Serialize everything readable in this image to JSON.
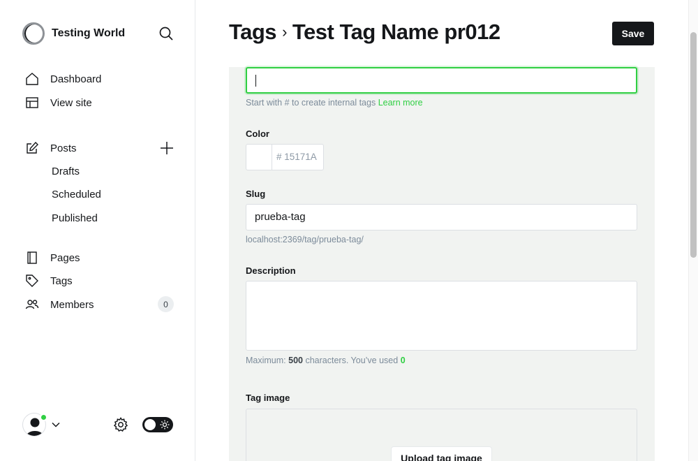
{
  "sidebar": {
    "site_name": "Testing World",
    "nav": [
      {
        "label": "Dashboard",
        "icon": "home-icon"
      },
      {
        "label": "View site",
        "icon": "layout-icon"
      }
    ],
    "posts": {
      "label": "Posts",
      "icon": "edit-icon"
    },
    "post_subitems": [
      "Drafts",
      "Scheduled",
      "Published"
    ],
    "pages": {
      "label": "Pages",
      "icon": "page-icon"
    },
    "tags": {
      "label": "Tags",
      "icon": "tag-icon"
    },
    "members": {
      "label": "Members",
      "icon": "members-icon",
      "count": "0"
    }
  },
  "header": {
    "breadcrumb_parent": "Tags",
    "separator": "›",
    "title": "Test Tag Name pr012",
    "save_label": "Save"
  },
  "form": {
    "name_value": "",
    "name_hint_prefix": "Start with # to create internal tags",
    "name_hint_link": "Learn more",
    "color_label": "Color",
    "color_placeholder": "# 15171A",
    "slug_label": "Slug",
    "slug_value": "prueba-tag",
    "slug_url": "localhost:2369/tag/prueba-tag/",
    "description_label": "Description",
    "description_value": "",
    "counter_prefix": "Maximum:",
    "counter_max": "500",
    "counter_middle": "characters. You’ve used",
    "counter_used": "0",
    "tag_image_label": "Tag image",
    "upload_label": "Upload tag image"
  },
  "colors": {
    "accent": "#30cf43",
    "primary": "#15171a",
    "card_bg": "#f1f3f1"
  }
}
